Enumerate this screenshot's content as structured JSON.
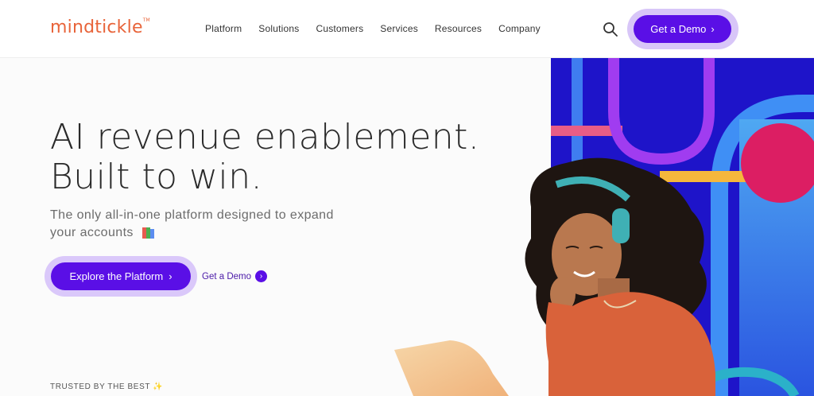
{
  "brand": {
    "name": "mindtickle",
    "tm": "TM"
  },
  "nav": {
    "items": [
      "Platform",
      "Solutions",
      "Customers",
      "Services",
      "Resources",
      "Company"
    ]
  },
  "header": {
    "demo_label": "Get a Demo",
    "demo_arrow": "›"
  },
  "hero": {
    "title_line1": "AI revenue enablement.",
    "title_line2": "Built to win.",
    "subtitle": "The only all-in-one platform designed to expand your accounts",
    "explore_label": "Explore the Platform",
    "explore_arrow": "›",
    "demo_link_label": "Get a Demo",
    "demo_link_arrow": "›"
  },
  "trusted": {
    "label": "TRUSTED BY THE BEST",
    "sparkle": "✨"
  },
  "colors": {
    "accent": "#5a0fe6",
    "brand": "#e8643a",
    "panel": "#1e14c9"
  },
  "icons": [
    "search-icon",
    "books-icon",
    "chevron-right-icon",
    "sparkle-icon"
  ]
}
